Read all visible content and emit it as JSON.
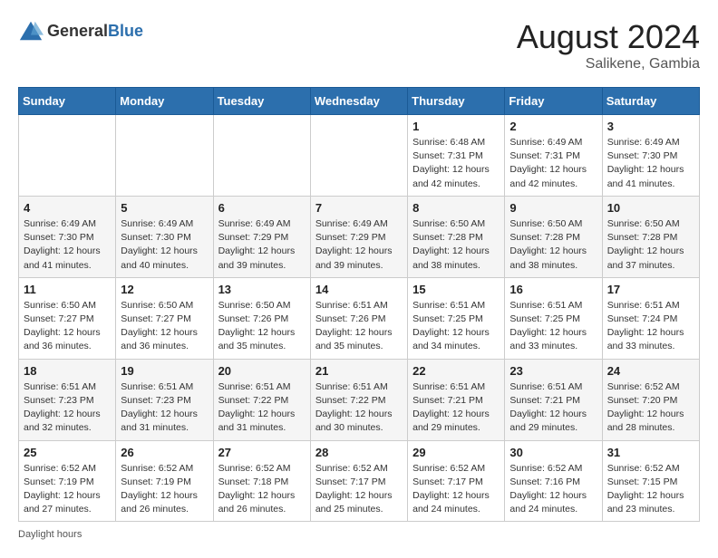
{
  "header": {
    "logo_general": "General",
    "logo_blue": "Blue",
    "month_year": "August 2024",
    "location": "Salikene, Gambia"
  },
  "days_of_week": [
    "Sunday",
    "Monday",
    "Tuesday",
    "Wednesday",
    "Thursday",
    "Friday",
    "Saturday"
  ],
  "footer": {
    "daylight_label": "Daylight hours"
  },
  "weeks": [
    [
      {
        "day": "",
        "sunrise": "",
        "sunset": "",
        "daylight": ""
      },
      {
        "day": "",
        "sunrise": "",
        "sunset": "",
        "daylight": ""
      },
      {
        "day": "",
        "sunrise": "",
        "sunset": "",
        "daylight": ""
      },
      {
        "day": "",
        "sunrise": "",
        "sunset": "",
        "daylight": ""
      },
      {
        "day": "1",
        "sunrise": "Sunrise: 6:48 AM",
        "sunset": "Sunset: 7:31 PM",
        "daylight": "Daylight: 12 hours and 42 minutes."
      },
      {
        "day": "2",
        "sunrise": "Sunrise: 6:49 AM",
        "sunset": "Sunset: 7:31 PM",
        "daylight": "Daylight: 12 hours and 42 minutes."
      },
      {
        "day": "3",
        "sunrise": "Sunrise: 6:49 AM",
        "sunset": "Sunset: 7:30 PM",
        "daylight": "Daylight: 12 hours and 41 minutes."
      }
    ],
    [
      {
        "day": "4",
        "sunrise": "Sunrise: 6:49 AM",
        "sunset": "Sunset: 7:30 PM",
        "daylight": "Daylight: 12 hours and 41 minutes."
      },
      {
        "day": "5",
        "sunrise": "Sunrise: 6:49 AM",
        "sunset": "Sunset: 7:30 PM",
        "daylight": "Daylight: 12 hours and 40 minutes."
      },
      {
        "day": "6",
        "sunrise": "Sunrise: 6:49 AM",
        "sunset": "Sunset: 7:29 PM",
        "daylight": "Daylight: 12 hours and 39 minutes."
      },
      {
        "day": "7",
        "sunrise": "Sunrise: 6:49 AM",
        "sunset": "Sunset: 7:29 PM",
        "daylight": "Daylight: 12 hours and 39 minutes."
      },
      {
        "day": "8",
        "sunrise": "Sunrise: 6:50 AM",
        "sunset": "Sunset: 7:28 PM",
        "daylight": "Daylight: 12 hours and 38 minutes."
      },
      {
        "day": "9",
        "sunrise": "Sunrise: 6:50 AM",
        "sunset": "Sunset: 7:28 PM",
        "daylight": "Daylight: 12 hours and 38 minutes."
      },
      {
        "day": "10",
        "sunrise": "Sunrise: 6:50 AM",
        "sunset": "Sunset: 7:28 PM",
        "daylight": "Daylight: 12 hours and 37 minutes."
      }
    ],
    [
      {
        "day": "11",
        "sunrise": "Sunrise: 6:50 AM",
        "sunset": "Sunset: 7:27 PM",
        "daylight": "Daylight: 12 hours and 36 minutes."
      },
      {
        "day": "12",
        "sunrise": "Sunrise: 6:50 AM",
        "sunset": "Sunset: 7:27 PM",
        "daylight": "Daylight: 12 hours and 36 minutes."
      },
      {
        "day": "13",
        "sunrise": "Sunrise: 6:50 AM",
        "sunset": "Sunset: 7:26 PM",
        "daylight": "Daylight: 12 hours and 35 minutes."
      },
      {
        "day": "14",
        "sunrise": "Sunrise: 6:51 AM",
        "sunset": "Sunset: 7:26 PM",
        "daylight": "Daylight: 12 hours and 35 minutes."
      },
      {
        "day": "15",
        "sunrise": "Sunrise: 6:51 AM",
        "sunset": "Sunset: 7:25 PM",
        "daylight": "Daylight: 12 hours and 34 minutes."
      },
      {
        "day": "16",
        "sunrise": "Sunrise: 6:51 AM",
        "sunset": "Sunset: 7:25 PM",
        "daylight": "Daylight: 12 hours and 33 minutes."
      },
      {
        "day": "17",
        "sunrise": "Sunrise: 6:51 AM",
        "sunset": "Sunset: 7:24 PM",
        "daylight": "Daylight: 12 hours and 33 minutes."
      }
    ],
    [
      {
        "day": "18",
        "sunrise": "Sunrise: 6:51 AM",
        "sunset": "Sunset: 7:23 PM",
        "daylight": "Daylight: 12 hours and 32 minutes."
      },
      {
        "day": "19",
        "sunrise": "Sunrise: 6:51 AM",
        "sunset": "Sunset: 7:23 PM",
        "daylight": "Daylight: 12 hours and 31 minutes."
      },
      {
        "day": "20",
        "sunrise": "Sunrise: 6:51 AM",
        "sunset": "Sunset: 7:22 PM",
        "daylight": "Daylight: 12 hours and 31 minutes."
      },
      {
        "day": "21",
        "sunrise": "Sunrise: 6:51 AM",
        "sunset": "Sunset: 7:22 PM",
        "daylight": "Daylight: 12 hours and 30 minutes."
      },
      {
        "day": "22",
        "sunrise": "Sunrise: 6:51 AM",
        "sunset": "Sunset: 7:21 PM",
        "daylight": "Daylight: 12 hours and 29 minutes."
      },
      {
        "day": "23",
        "sunrise": "Sunrise: 6:51 AM",
        "sunset": "Sunset: 7:21 PM",
        "daylight": "Daylight: 12 hours and 29 minutes."
      },
      {
        "day": "24",
        "sunrise": "Sunrise: 6:52 AM",
        "sunset": "Sunset: 7:20 PM",
        "daylight": "Daylight: 12 hours and 28 minutes."
      }
    ],
    [
      {
        "day": "25",
        "sunrise": "Sunrise: 6:52 AM",
        "sunset": "Sunset: 7:19 PM",
        "daylight": "Daylight: 12 hours and 27 minutes."
      },
      {
        "day": "26",
        "sunrise": "Sunrise: 6:52 AM",
        "sunset": "Sunset: 7:19 PM",
        "daylight": "Daylight: 12 hours and 26 minutes."
      },
      {
        "day": "27",
        "sunrise": "Sunrise: 6:52 AM",
        "sunset": "Sunset: 7:18 PM",
        "daylight": "Daylight: 12 hours and 26 minutes."
      },
      {
        "day": "28",
        "sunrise": "Sunrise: 6:52 AM",
        "sunset": "Sunset: 7:17 PM",
        "daylight": "Daylight: 12 hours and 25 minutes."
      },
      {
        "day": "29",
        "sunrise": "Sunrise: 6:52 AM",
        "sunset": "Sunset: 7:17 PM",
        "daylight": "Daylight: 12 hours and 24 minutes."
      },
      {
        "day": "30",
        "sunrise": "Sunrise: 6:52 AM",
        "sunset": "Sunset: 7:16 PM",
        "daylight": "Daylight: 12 hours and 24 minutes."
      },
      {
        "day": "31",
        "sunrise": "Sunrise: 6:52 AM",
        "sunset": "Sunset: 7:15 PM",
        "daylight": "Daylight: 12 hours and 23 minutes."
      }
    ]
  ]
}
